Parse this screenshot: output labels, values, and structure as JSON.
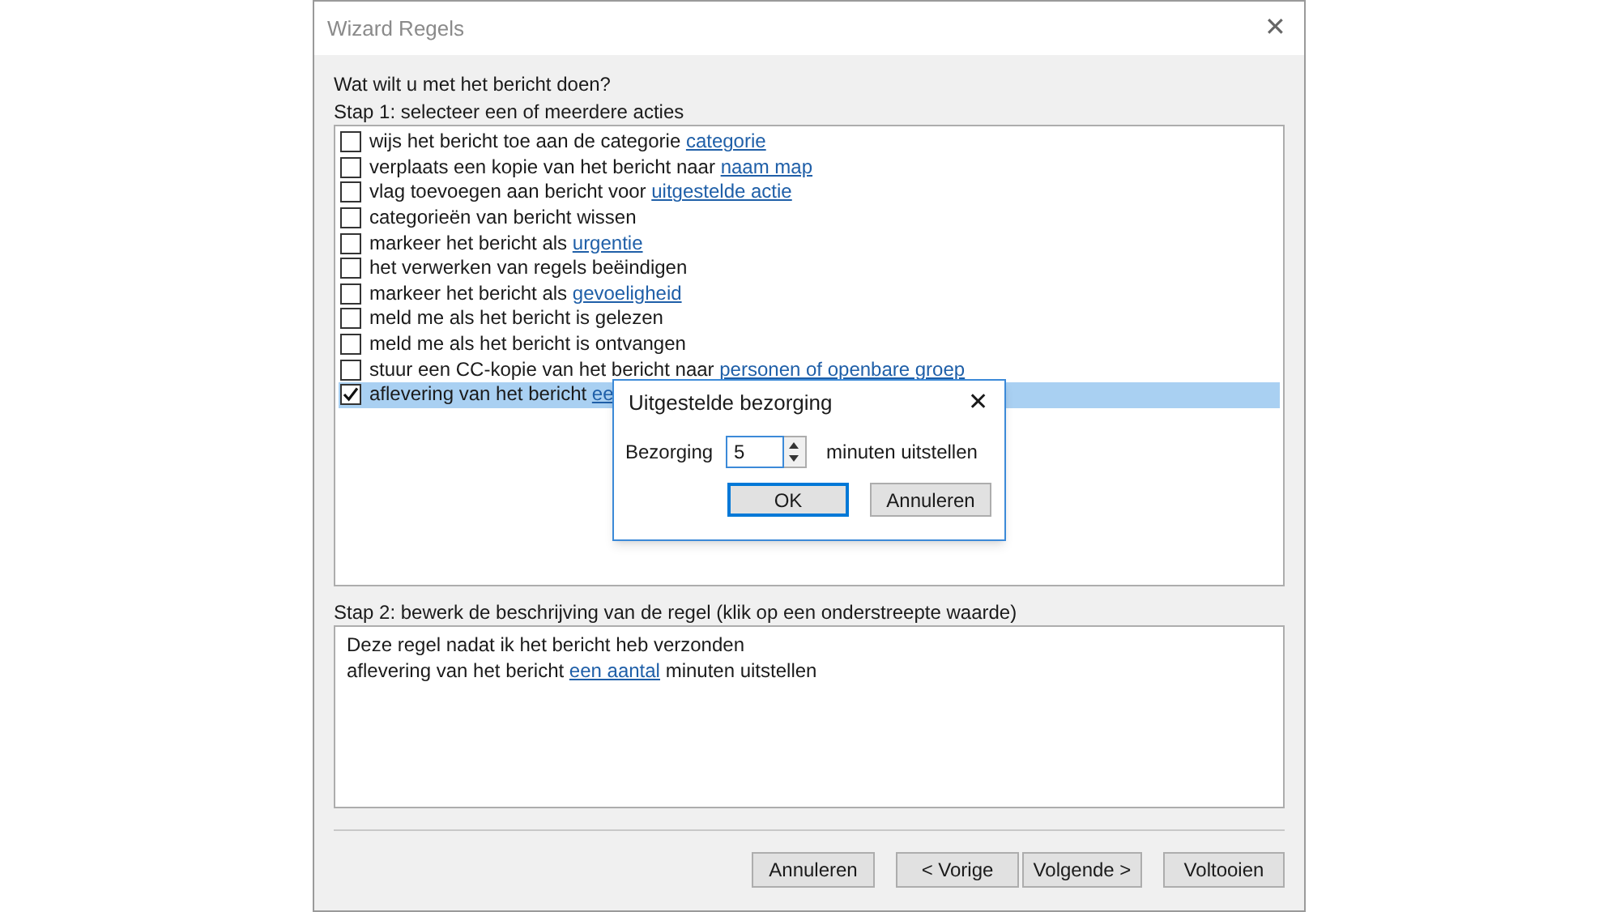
{
  "window": {
    "title": "Wizard Regels",
    "close": "✕"
  },
  "question": "Wat wilt u met het bericht doen?",
  "step1": {
    "label": "Stap 1: selecteer een of meerdere acties",
    "actions": [
      {
        "text": "wijs het bericht toe aan de categorie ",
        "link": "categorie",
        "checked": false,
        "selected": false
      },
      {
        "text": "verplaats een kopie van het bericht naar ",
        "link": "naam map",
        "checked": false,
        "selected": false
      },
      {
        "text": "vlag toevoegen aan bericht voor ",
        "link": "uitgestelde actie",
        "checked": false,
        "selected": false
      },
      {
        "text": "categorieën van bericht wissen",
        "checked": false,
        "selected": false
      },
      {
        "text": "markeer het bericht als ",
        "link": "urgentie",
        "checked": false,
        "selected": false
      },
      {
        "text": "het verwerken van regels beëindigen",
        "checked": false,
        "selected": false
      },
      {
        "text": "markeer het bericht als ",
        "link": "gevoeligheid",
        "checked": false,
        "selected": false
      },
      {
        "text": "meld me als het bericht is gelezen",
        "checked": false,
        "selected": false
      },
      {
        "text": "meld me als het bericht is ontvangen",
        "checked": false,
        "selected": false
      },
      {
        "text": "stuur een CC-kopie van het bericht naar ",
        "link": "personen of openbare groep",
        "checked": false,
        "selected": false
      },
      {
        "text": "aflevering van het bericht ",
        "link": "ee",
        "checked": true,
        "selected": true
      }
    ]
  },
  "step2": {
    "label": "Stap 2: bewerk de beschrijving van de regel (klik op een onderstreepte waarde)",
    "lines": [
      {
        "text": "Deze regel nadat ik het bericht heb verzonden"
      },
      {
        "text": "aflevering van het bericht ",
        "link": "een aantal",
        "after": " minuten uitstellen"
      }
    ]
  },
  "buttons": [
    {
      "label": "Annuleren"
    },
    {
      "label": "< Vorige"
    },
    {
      "label": "Volgende >"
    },
    {
      "label": "Voltooien"
    }
  ],
  "popup": {
    "title": "Uitgestelde bezorging",
    "close": "✕",
    "field_label": "Bezorging",
    "value": "5",
    "unit": "minuten uitstellen",
    "buttons": [
      {
        "label": "OK",
        "default": true
      },
      {
        "label": "Annuleren",
        "default": false
      }
    ]
  }
}
